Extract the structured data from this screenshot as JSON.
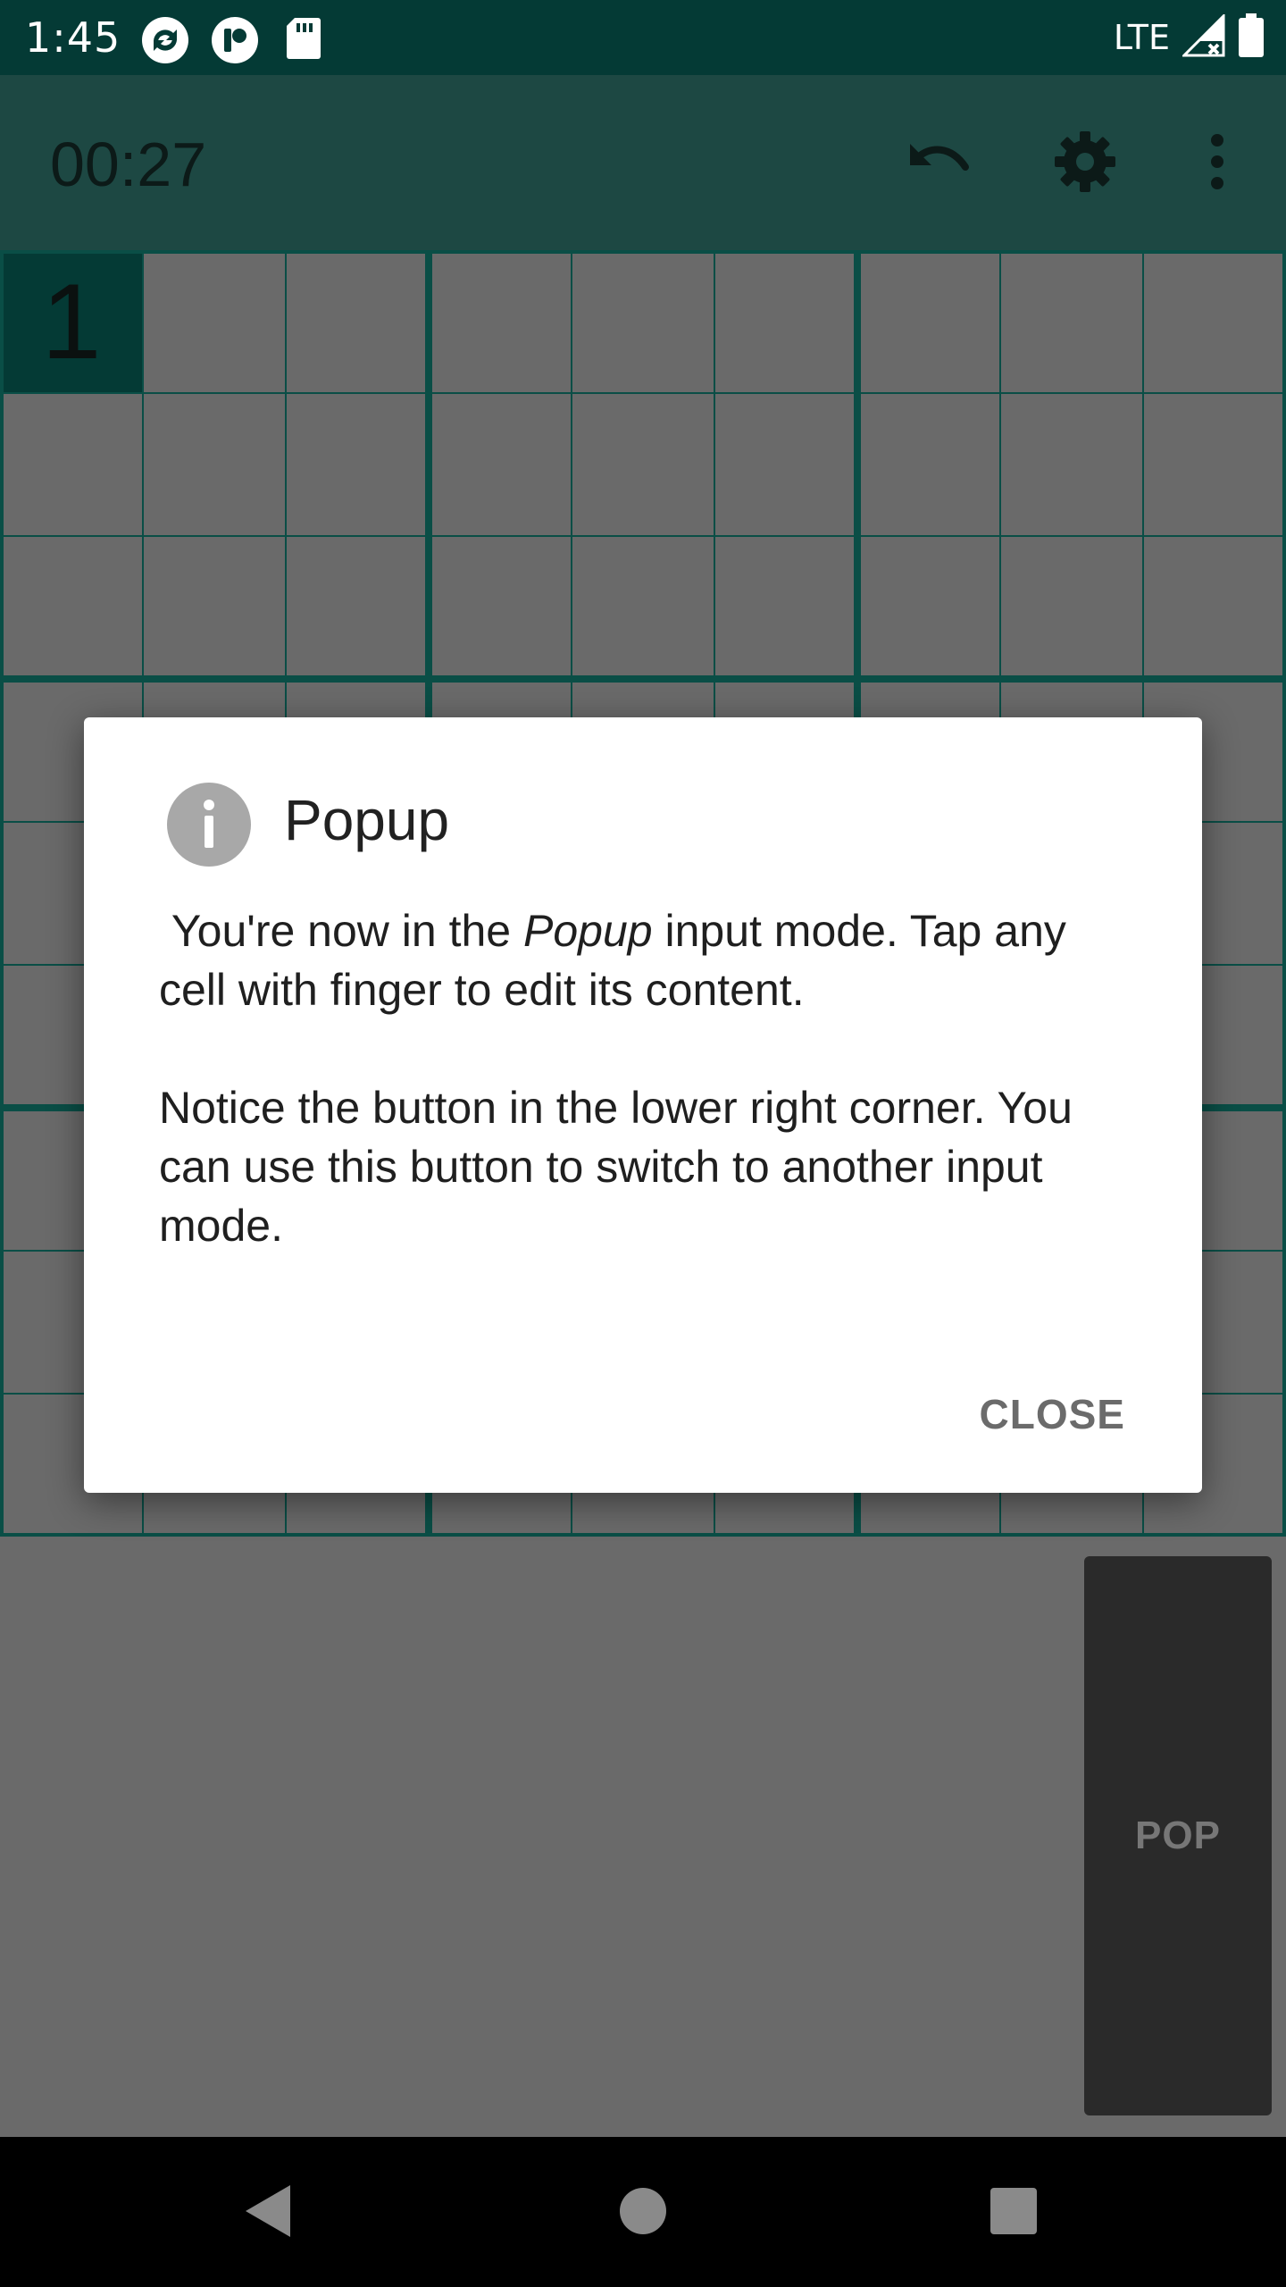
{
  "status_bar": {
    "time": "1:45",
    "network": "LTE",
    "icons": [
      "sync-app-icon",
      "camera-app-icon",
      "sd-card-icon",
      "signal-icon",
      "battery-icon"
    ]
  },
  "toolbar": {
    "timer": "00:27",
    "undo_icon": "undo-icon",
    "settings_icon": "gear-icon",
    "menu_icon": "more-vert-icon"
  },
  "grid": {
    "size": 9,
    "selected_cell": {
      "row": 0,
      "col": 0
    },
    "cells": [
      {
        "row": 0,
        "col": 0,
        "value": "1"
      }
    ]
  },
  "input_mode_button": {
    "label": "POP"
  },
  "dialog": {
    "title": "Popup",
    "icon": "info-icon",
    "message_pre": " You're now in the ",
    "message_em": "Popup",
    "message_post": " input mode. Tap any cell with finger to edit its content.",
    "message_2": "Notice the button in the lower right corner. You can use this button to switch to another input mode.",
    "close_label": "CLOSE"
  },
  "nav_bar": {
    "back_icon": "back-triangle-icon",
    "home_icon": "home-circle-icon",
    "recents_icon": "recents-square-icon"
  },
  "colors": {
    "status_bar": "#043a35",
    "toolbar": "#1d4843",
    "grid_line": "#0a4e46",
    "cell_dimmed": "#6a6a6a",
    "selected_cell": "#043a35",
    "overlay_background": "#6a6a6a"
  }
}
